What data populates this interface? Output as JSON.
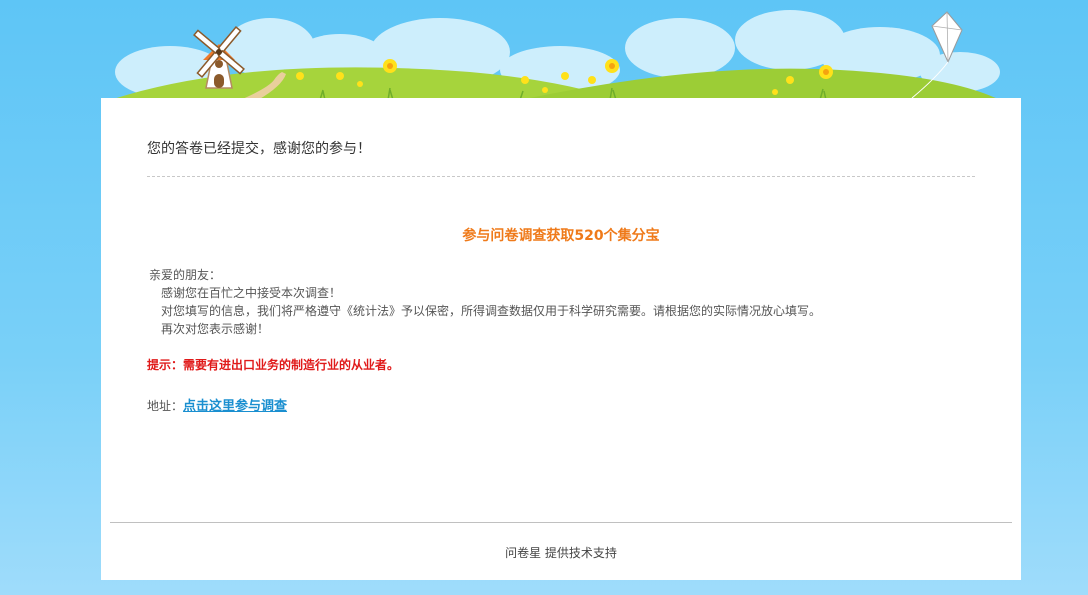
{
  "message": {
    "thanks": "您的答卷已经提交，感谢您的参与！"
  },
  "promo": {
    "title": "参与问卷调查获取520个集分宝",
    "greeting": "亲爱的朋友：",
    "lines": [
      "感谢您在百忙之中接受本次调查！",
      "对您填写的信息，我们将严格遵守《统计法》予以保密，所得调查数据仅用于科学研究需要。请根据您的实际情况放心填写。",
      "再次对您表示感谢！"
    ],
    "tip": "提示：需要有进出口业务的制造行业的从业者。",
    "address_label": "地址：",
    "link_text": "点击这里参与调查"
  },
  "footer": {
    "support": "问卷星 提供技术支持"
  },
  "colors": {
    "sky": "#5ec5f6",
    "grass": "#a6d43c",
    "headline": "#ef7a1a",
    "tip": "#e01a1a",
    "link": "#1a8fd0"
  },
  "icons": [
    "windmill-icon",
    "kite-icon",
    "flower-icon"
  ]
}
